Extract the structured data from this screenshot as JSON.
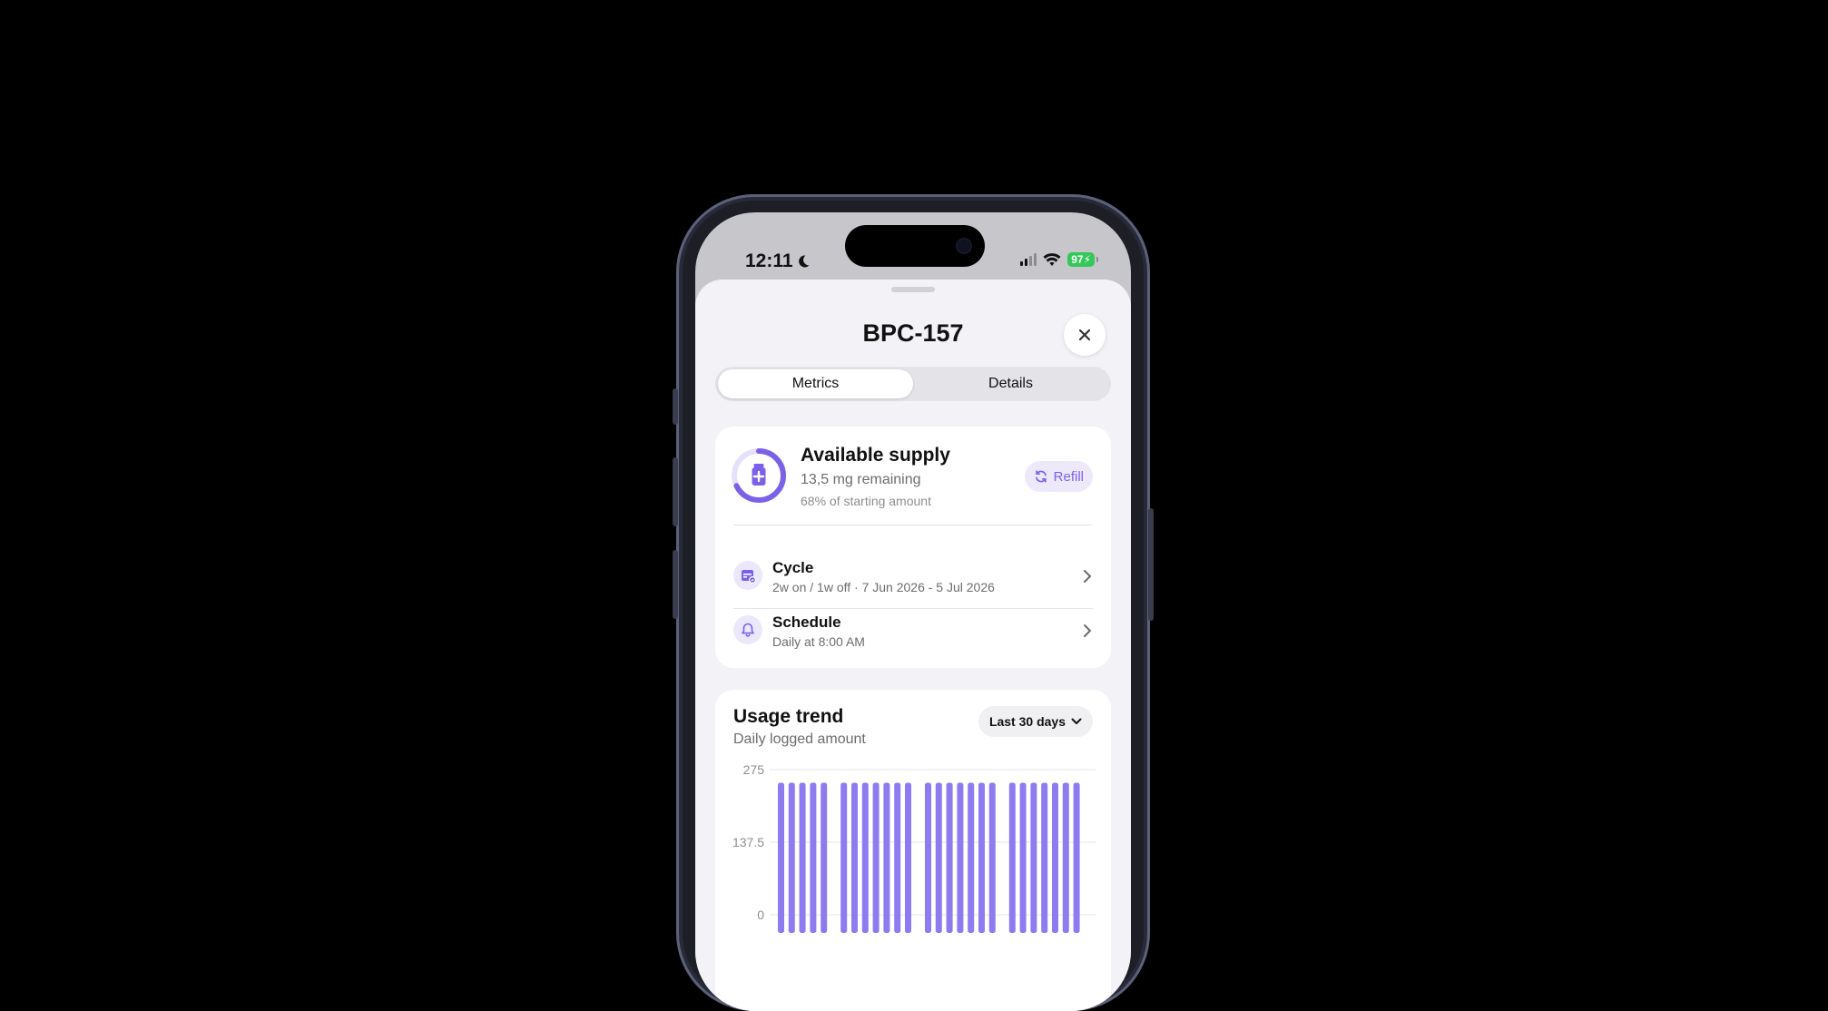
{
  "status_bar": {
    "time": "12:11",
    "battery": "97"
  },
  "sheet": {
    "title": "BPC-157",
    "tabs": [
      {
        "label": "Metrics",
        "active": true
      },
      {
        "label": "Details",
        "active": false
      }
    ]
  },
  "supply": {
    "title": "Available supply",
    "remaining": "13,5 mg remaining",
    "percent_text": "68% of starting amount",
    "percent": 68,
    "refill_label": "Refill"
  },
  "rows": [
    {
      "title": "Cycle",
      "subtitle": "2w on / 1w off · 7 Jun 2026 - 5 Jul 2026",
      "icon": "calendar-icon"
    },
    {
      "title": "Schedule",
      "subtitle": "Daily at 8:00 AM",
      "icon": "bell-icon"
    }
  ],
  "trend": {
    "title": "Usage trend",
    "subtitle": "Daily logged amount",
    "range_label": "Last 30 days"
  },
  "colors": {
    "accent": "#7b61e8",
    "bar": "#8f7bf0",
    "background": "#f2f2f7"
  },
  "chart_data": {
    "type": "bar",
    "y_ticks": [
      "275",
      "137.5",
      "0"
    ],
    "ylim": [
      0,
      275
    ],
    "groups": [
      [
        250,
        250,
        250,
        250,
        250
      ],
      [
        250,
        250,
        250,
        250,
        250,
        250,
        250
      ],
      [
        250,
        250,
        250,
        250,
        250,
        250,
        250
      ],
      [
        250,
        250,
        250,
        250,
        250,
        250,
        250
      ]
    ]
  }
}
